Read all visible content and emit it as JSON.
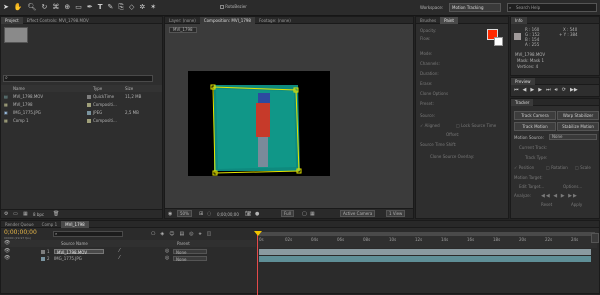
{
  "toolbar": {
    "roto": "RotoBezier",
    "workspace_label": "Workspace:",
    "workspace_value": "Motion Tracking",
    "search_placeholder": "Search Help"
  },
  "project": {
    "tabs": [
      "Project",
      "Effect Controls: MVI_1798.MOV"
    ],
    "search": "",
    "headers": {
      "name": "Name",
      "type": "Type",
      "size": "Size"
    },
    "items": [
      {
        "name": "MVI_1798.MOV",
        "type": "QuickTime",
        "size": "11,2 MB",
        "color": "#7e7e7e"
      },
      {
        "name": "MVI_1798",
        "type": "Compositi...",
        "size": "",
        "color": "#a0a07a"
      },
      {
        "name": "IMG_1775.JPG",
        "type": "JPEG",
        "size": "2,5 MB",
        "color": "#7a94a0"
      },
      {
        "name": "Comp 1",
        "type": "Compositi...",
        "size": "",
        "color": "#a0a07a"
      }
    ],
    "bpc": "8 bpc"
  },
  "viewer": {
    "tabs": [
      "Layer: (none)",
      "Composition: MVI_1798",
      "Footage: (none)"
    ],
    "breadcrumb": "MVI_1798",
    "zoom": "50%",
    "timecode": "0;00;00;00",
    "resolution": "Full",
    "camera": "Active Camera",
    "views": "1 View"
  },
  "brushes": {
    "tabs": [
      "Brushes",
      "Paint"
    ],
    "opacity": "Opacity:",
    "flow": "Flow:",
    "mode": "Mode:",
    "channels": "Channels:",
    "duration": "Duration:",
    "erase": "Erase:",
    "clone_options": "Clone Options",
    "preset": "Preset:",
    "source": "Source:",
    "aligned": "Aligned",
    "lock_source": "Lock Source Time",
    "offset": "Offset:",
    "source_time": "Source Time Shift:",
    "clone_overlay": "Clone Source Overlay:",
    "fg_color": "#ff2a00"
  },
  "info": {
    "tab": "Info",
    "r": "R : 160",
    "g": "G : 152",
    "b": "B : 154",
    "a": "A : 255",
    "x": "X : 540",
    "y": "+ Y : 384",
    "layer": "MVI_1798.MOV",
    "mask": "Mask: Mask 1",
    "vertices": "Vertices: 4"
  },
  "preview": {
    "tab": "Preview"
  },
  "tracker": {
    "tab": "Tracker",
    "buttons": [
      "Track Camera",
      "Warp Stabilizer",
      "Track Motion",
      "Stabilize Motion"
    ],
    "motion_source_label": "Motion Source:",
    "motion_source": "None",
    "current_track": "Current Track:",
    "track_type": "Track Type:",
    "position": "Position",
    "rotation": "Rotation",
    "scale": "Scale",
    "motion_target": "Motion Target:",
    "edit_target": "Edit Target...",
    "options": "Options...",
    "analyze": "Analyze:",
    "reset": "Reset",
    "apply": "Apply"
  },
  "timeline": {
    "tabs": [
      "Render Queue",
      "Comp 1",
      "MVI_1798"
    ],
    "timecode": "0;00;00;00",
    "frames": "00000 (29.97 fps)",
    "headers": {
      "source": "Source Name",
      "parent": "Parent"
    },
    "layers": [
      {
        "num": "1",
        "name": "MVI_1798.MOV",
        "parent": "None",
        "color": "#7e7e7e"
      },
      {
        "num": "2",
        "name": "IMG_1775.JPG",
        "parent": "None",
        "color": "#7a94a0"
      }
    ],
    "ruler": [
      "0s",
      "02s",
      "04s",
      "06s",
      "08s",
      "10s",
      "12s",
      "14s",
      "16s",
      "18s",
      "20s",
      "22s",
      "24s"
    ]
  }
}
